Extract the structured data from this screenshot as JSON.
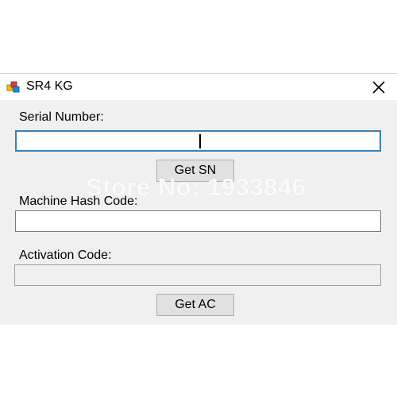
{
  "window": {
    "title": "SR4 KG",
    "close_glyph": "✕"
  },
  "form": {
    "serial_label": "Serial Number:",
    "serial_value": "",
    "get_sn_label": "Get SN",
    "hash_label": "Machine Hash Code:",
    "hash_value": "",
    "activation_label": "Activation Code:",
    "activation_value": "",
    "get_ac_label": "Get AC"
  },
  "watermark": "Store No: 1933846",
  "colors": {
    "focus_border": "#3c7fb1",
    "window_bg": "#f0f0f0",
    "button_bg": "#e1e1e1"
  },
  "icons": {
    "app": "app-icon",
    "close": "close-icon"
  }
}
